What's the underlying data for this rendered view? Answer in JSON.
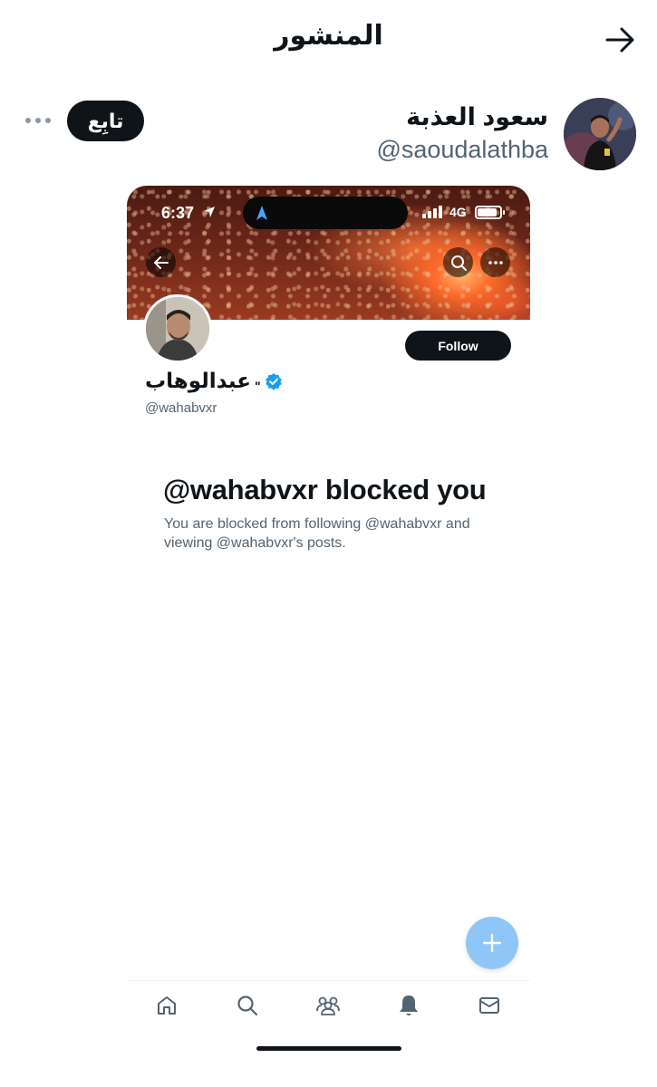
{
  "header": {
    "title": "المنشور",
    "back_icon": "arrow-right-icon"
  },
  "post": {
    "author_name": "سعود العذبة",
    "author_handle": "@saoudalathba",
    "follow_label": "تابِع",
    "more_icon": "more-horizontal-icon"
  },
  "embedded_screenshot": {
    "status_bar": {
      "time": "6:37",
      "network": "4G"
    },
    "profile": {
      "name": "عبدالوهاب",
      "name_suffix": "\"",
      "handle": "@wahabvxr",
      "verified": true,
      "follow_label": "Follow"
    },
    "blocked_notice": {
      "title": "@wahabvxr blocked you",
      "description": "You are blocked from following @wahabvxr and viewing @wahabvxr's posts."
    },
    "tabs": [
      {
        "icon": "home-icon"
      },
      {
        "icon": "search-icon"
      },
      {
        "icon": "communities-icon"
      },
      {
        "icon": "notifications-icon"
      },
      {
        "icon": "messages-icon"
      }
    ]
  },
  "colors": {
    "text": "#0f1419",
    "secondary": "#536471",
    "verified": "#1d9bf0",
    "fab": "#8ec7f7"
  }
}
